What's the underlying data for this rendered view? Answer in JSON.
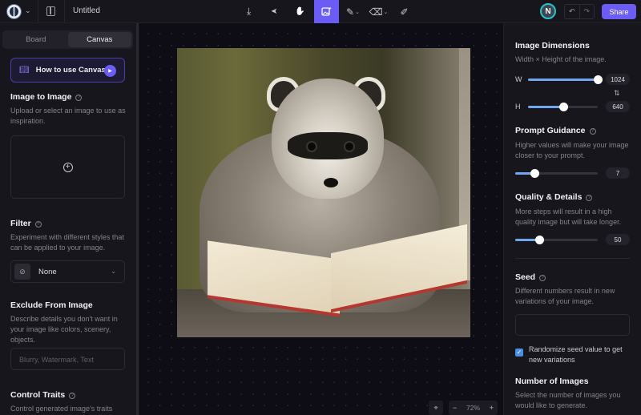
{
  "topbar": {
    "title": "Untitled",
    "tools": [
      {
        "name": "import-icon",
        "glyph": "⤓"
      },
      {
        "name": "select-arrow-icon",
        "glyph": "➤"
      },
      {
        "name": "hand-pan-icon",
        "glyph": "✋"
      },
      {
        "name": "image-generate-icon",
        "glyph": "🖾",
        "active": true
      },
      {
        "name": "pencil-brush-icon",
        "glyph": "✎",
        "dropdown": true
      },
      {
        "name": "eraser-icon",
        "glyph": "⌫",
        "dropdown": true
      },
      {
        "name": "magic-wand-icon",
        "glyph": "⚲"
      }
    ],
    "avatar_initial": "N",
    "undo_glyph": "↶",
    "redo_glyph": "↷",
    "share_label": "Share"
  },
  "left": {
    "tabs": [
      {
        "label": "Board",
        "active": false
      },
      {
        "label": "Canvas",
        "active": true
      }
    ],
    "howto_label": "How to use Canvas",
    "image_to_image": {
      "title": "Image to Image",
      "desc": "Upload or select an image to use as inspiration."
    },
    "filter": {
      "title": "Filter",
      "desc": "Experiment with different styles that can be applied to your image.",
      "selected": "None"
    },
    "exclude": {
      "title": "Exclude From Image",
      "desc": "Describe details you don't want in your image like colors, scenery, objects.",
      "placeholder": "Blurry, Watermark, Text"
    },
    "control_traits": {
      "title": "Control Traits",
      "desc": "Control generated image's traits"
    }
  },
  "canvas": {
    "image_alt": "Raccoon reading an open book",
    "zoom_level": "72%",
    "zoom_minus": "−",
    "zoom_plus": "+"
  },
  "right": {
    "dimensions": {
      "title": "Image Dimensions",
      "desc": "Width × Height of the image.",
      "width_label": "W",
      "width": "1024",
      "width_fraction": 1.0,
      "height_label": "H",
      "height": "640",
      "height_fraction": 0.5
    },
    "prompt_guidance": {
      "title": "Prompt Guidance",
      "desc": "Higher values will make your image closer to your prompt.",
      "value": "7",
      "fraction": 0.23
    },
    "quality": {
      "title": "Quality & Details",
      "desc": "More steps will result in a high quality image but will take longer.",
      "value": "50",
      "fraction": 0.29
    },
    "seed": {
      "title": "Seed",
      "desc": "Different numbers result in new variations of your image.",
      "value": "",
      "randomize_label": "Randomize seed value to get new variations",
      "randomize_checked": true
    },
    "num_images": {
      "title": "Number of Images",
      "desc": "Select the number of images you would like to generate."
    }
  }
}
